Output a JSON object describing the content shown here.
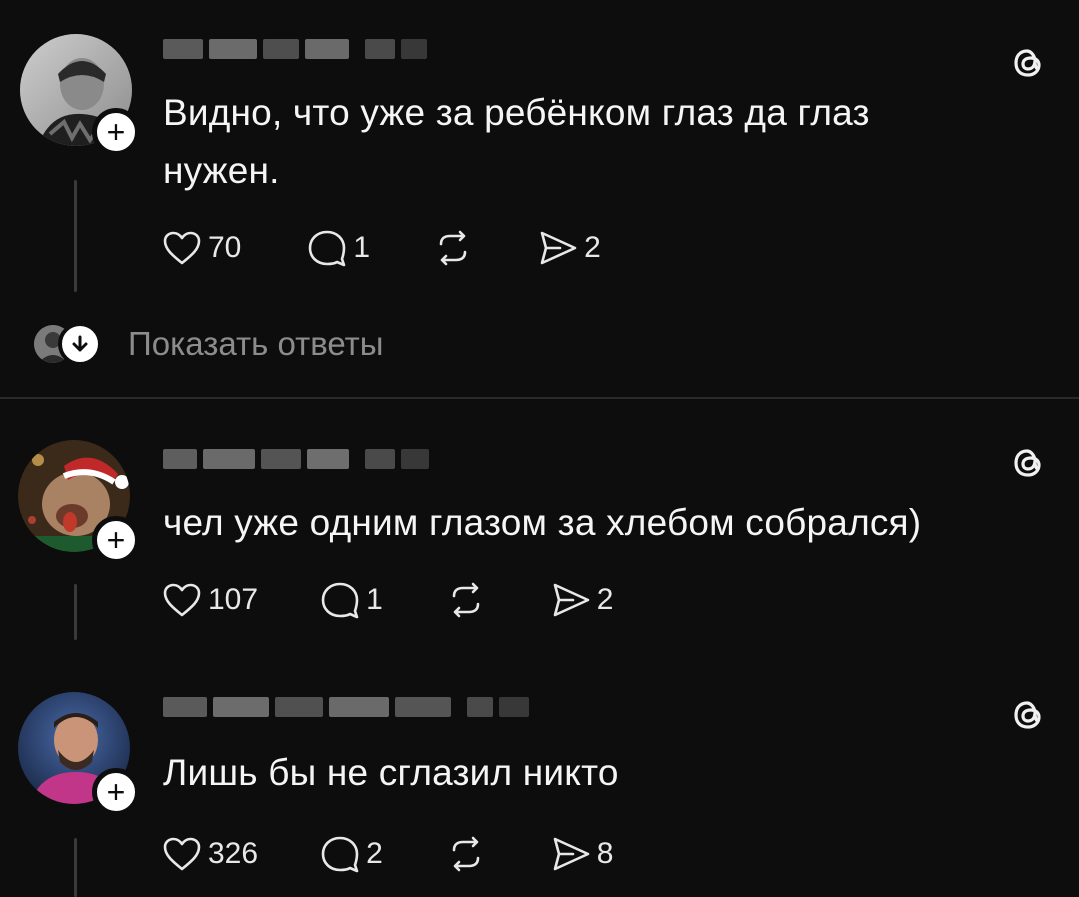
{
  "show_replies_label": "Показать ответы",
  "posts": [
    {
      "text_line1": "Видно, что уже за ребёнком глаз да глаз",
      "text_line2": "нужен.",
      "likes": "70",
      "replies": "1",
      "shares": "2"
    },
    {
      "text_line1": "чел уже одним глазом за хлебом собрался)",
      "likes": "107",
      "replies": "1",
      "shares": "2"
    },
    {
      "text_line1": "Лишь бы не сглазил никто",
      "likes": "326",
      "replies": "2",
      "shares": "8"
    }
  ],
  "icons": {
    "like": "heart-icon",
    "reply": "comment-icon",
    "repost": "repost-icon",
    "share": "send-icon",
    "follow": "plus-icon",
    "brand": "threads-logo-icon",
    "expand": "arrow-down-icon"
  },
  "colors": {
    "background": "#0d0d0d",
    "text": "#f5f5f5",
    "muted": "#8c8c8c",
    "divider": "#2a2a2a"
  }
}
